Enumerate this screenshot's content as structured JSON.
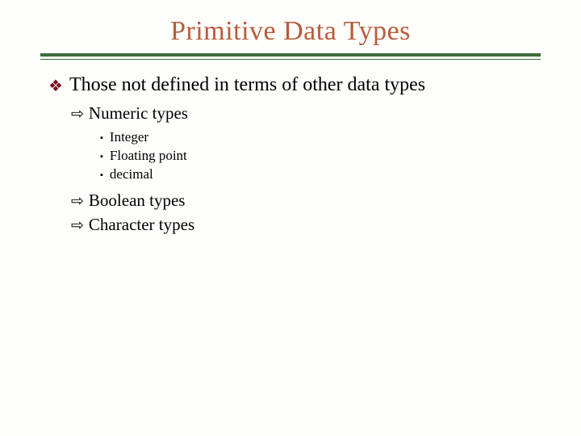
{
  "title": "Primitive Data Types",
  "bullets": {
    "l1": "Those not defined in terms of other data types",
    "l2a": "Numeric types",
    "l3a": "Integer",
    "l3b": "Floating point",
    "l3c": "decimal",
    "l2b": "Boolean types",
    "l2c": "Character types"
  },
  "glyphs": {
    "diamond4": "❖",
    "arrow": "⇨",
    "square": "▪"
  }
}
